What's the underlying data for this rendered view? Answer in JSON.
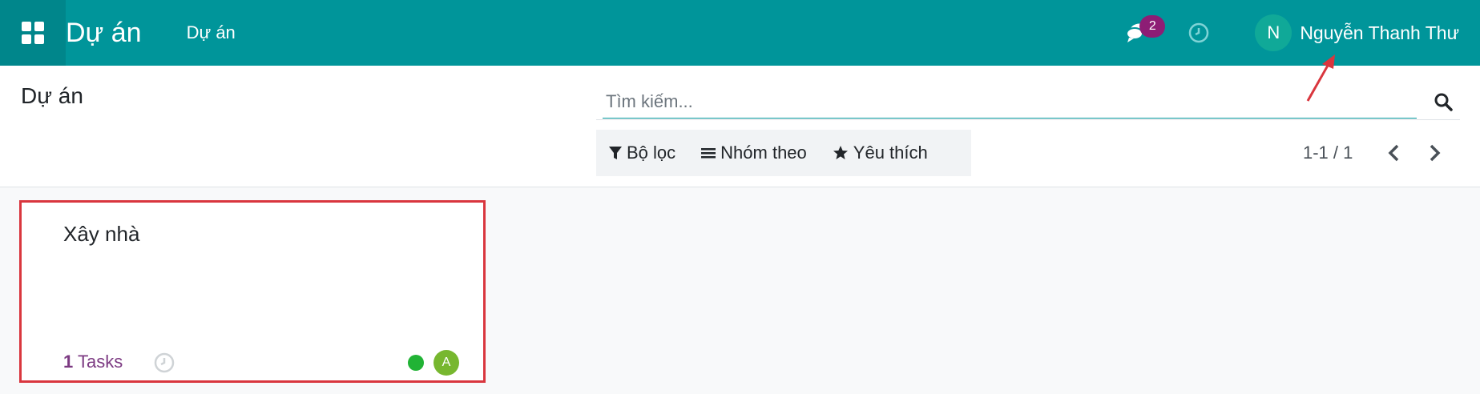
{
  "navbar": {
    "app_title": "Dự án",
    "menu_item": "Dự án",
    "messages_count": "2",
    "user_initial": "N",
    "user_name": "Nguyễn Thanh Thư",
    "color": "#00959a"
  },
  "control_panel": {
    "page_title": "Dự án",
    "search_placeholder": "Tìm kiếm...",
    "filters_label": "Bộ lọc",
    "group_by_label": "Nhóm theo",
    "favorites_label": "Yêu thích",
    "pager": "1-1 / 1"
  },
  "kanban": {
    "card": {
      "title": "Xây nhà",
      "task_count": "1",
      "task_label": " Tasks",
      "status_color": "#21b335",
      "assignee_initial": "A"
    }
  },
  "annotations": {
    "highlight_color": "#d9363e"
  }
}
